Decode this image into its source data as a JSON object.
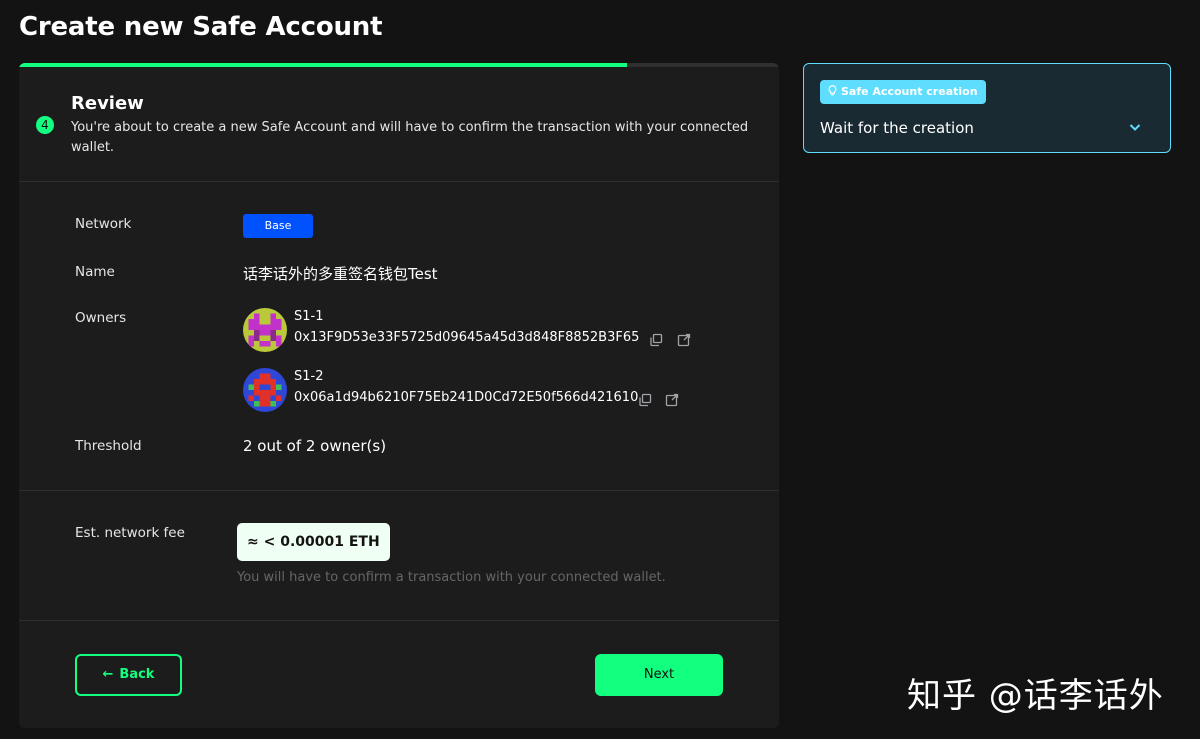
{
  "page_title": "Create new Safe Account",
  "progress": {
    "fraction": 0.8,
    "color": "#12ff80"
  },
  "step": {
    "number": "4",
    "title": "Review",
    "description": "You're about to create a new Safe Account and will have to confirm the transaction with your connected wallet."
  },
  "review": {
    "network_label": "Network",
    "network_value": "Base",
    "network_color": "#0052ff",
    "name_label": "Name",
    "name_value": "话李话外的多重签名钱包Test",
    "owners_label": "Owners",
    "owners": [
      {
        "name": "S1-1",
        "address": "0x13F9D53e33F5725d09645a45d3d848F8852B3F65",
        "avatar_icon": "identicon-yellow-magenta"
      },
      {
        "name": "S1-2",
        "address": "0x06a1d94b6210F75Eb241D0Cd72E50f566d421610",
        "avatar_icon": "identicon-blue-red"
      }
    ],
    "threshold_label": "Threshold",
    "threshold_value": "2 out of 2 owner(s)"
  },
  "fee": {
    "label": "Est. network fee",
    "value": "≈ < 0.00001 ETH",
    "hint": "You will have to confirm a transaction with your connected wallet."
  },
  "buttons": {
    "back_label": "Back",
    "next_label": "Next"
  },
  "side_panel": {
    "chip_label": "Safe Account creation",
    "text": "Wait for the creation"
  },
  "watermark": "知乎 @话李话外",
  "colors": {
    "accent": "#12ff80",
    "info": "#5fddff",
    "background": "#121312",
    "card": "#1c1c1c"
  }
}
